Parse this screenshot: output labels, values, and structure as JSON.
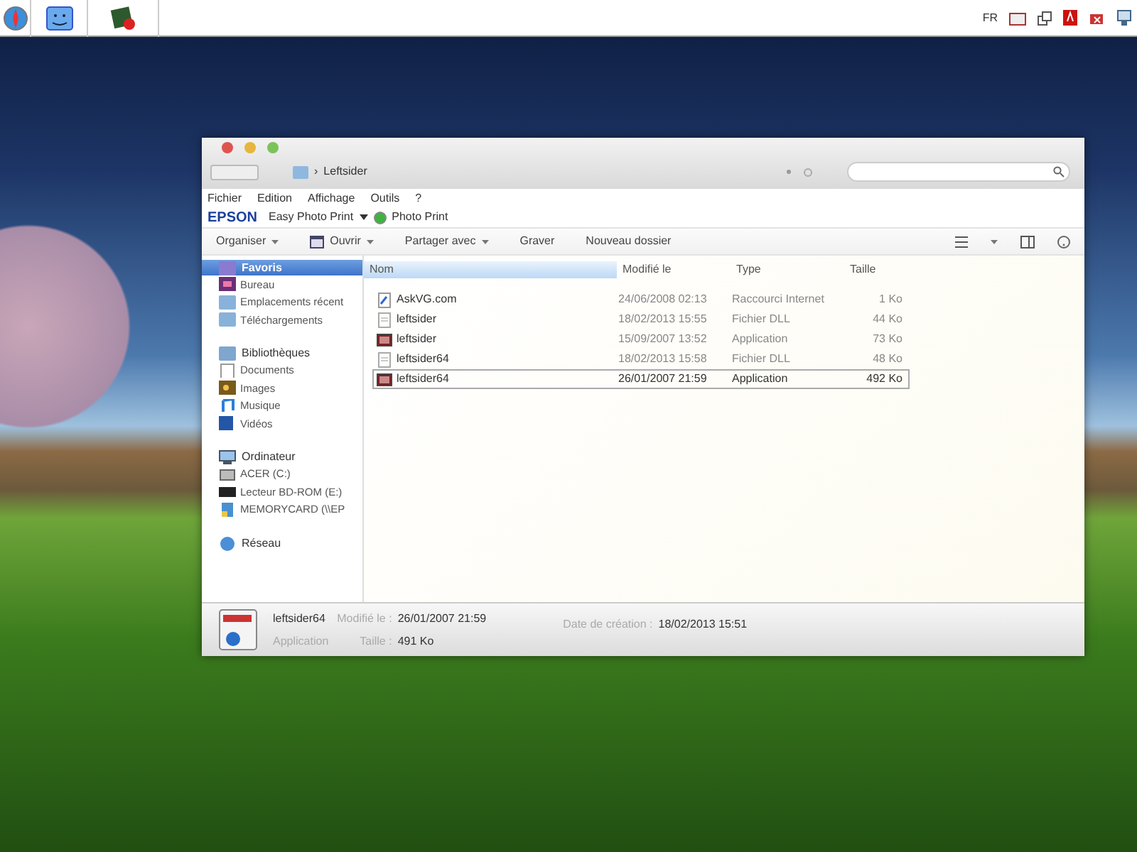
{
  "taskbar": {
    "language": "FR"
  },
  "window": {
    "breadcrumb_separator": "›",
    "location": "Leftsider"
  },
  "menu_bar": [
    "Fichier",
    "Edition",
    "Affichage",
    "Outils",
    "?"
  ],
  "epson_bar": {
    "brand": "EPSON",
    "app": "Easy Photo Print",
    "photo_print": "Photo Print"
  },
  "toolbar": [
    {
      "label": "Organiser",
      "dropdown": true
    },
    {
      "label": "Ouvrir",
      "dropdown": true
    },
    {
      "label": "Partager avec",
      "dropdown": true
    },
    {
      "label": "Graver",
      "dropdown": false
    },
    {
      "label": "Nouveau dossier",
      "dropdown": false
    }
  ],
  "sidebar": [
    {
      "label": "Favoris",
      "selected": true,
      "children": [
        {
          "label": "Bureau",
          "selected": false
        },
        {
          "label": "Emplacements récent",
          "selected": false
        },
        {
          "label": "Téléchargements",
          "selected": false
        }
      ]
    },
    {
      "label": "Bibliothèques",
      "selected": false,
      "children": [
        {
          "label": "Documents",
          "selected": false
        },
        {
          "label": "Images",
          "selected": false
        },
        {
          "label": "Musique",
          "selected": false
        },
        {
          "label": "Vidéos",
          "selected": false
        }
      ]
    },
    {
      "label": "Ordinateur",
      "selected": false,
      "children": [
        {
          "label": "ACER (C:)",
          "selected": false
        },
        {
          "label": "Lecteur BD-ROM (E:)",
          "selected": false
        },
        {
          "label": "MEMORYCARD (\\\\EP",
          "selected": false
        }
      ]
    },
    {
      "label": "Réseau",
      "selected": false
    }
  ],
  "table": {
    "columns": [
      {
        "label": "Nom",
        "sorted": true
      },
      {
        "label": "Modifié le",
        "sorted": false
      },
      {
        "label": "Type",
        "sorted": false
      },
      {
        "label": "Taille",
        "sorted": false
      }
    ],
    "rows": [
      {
        "kind": "shortcut",
        "name": "AskVG.com",
        "modified": "24/06/2008 02:13",
        "type": "Raccourci Internet",
        "size": "1 Ko",
        "selected": false
      },
      {
        "kind": "dll",
        "name": "leftsider",
        "modified": "18/02/2013 15:55",
        "type": "Fichier DLL",
        "size": "44 Ko",
        "selected": false
      },
      {
        "kind": "application",
        "name": "leftsider",
        "modified": "15/09/2007 13:52",
        "type": "Application",
        "size": "73 Ko",
        "selected": false
      },
      {
        "kind": "dll",
        "name": "leftsider64",
        "modified": "18/02/2013 15:58",
        "type": "Fichier DLL",
        "size": "48 Ko",
        "selected": false
      },
      {
        "kind": "application",
        "name": "leftsider64",
        "modified": "26/01/2007 21:59",
        "type": "Application",
        "size": "492 Ko",
        "selected": true
      }
    ]
  },
  "details": {
    "name": "leftsider64",
    "type": "Application",
    "modified_label": "Modifié le :",
    "modified": "26/01/2007 21:59",
    "size_label": "Taille :",
    "size": "491 Ko",
    "created_label": "Date de création :",
    "created": "18/02/2013 15:51"
  }
}
